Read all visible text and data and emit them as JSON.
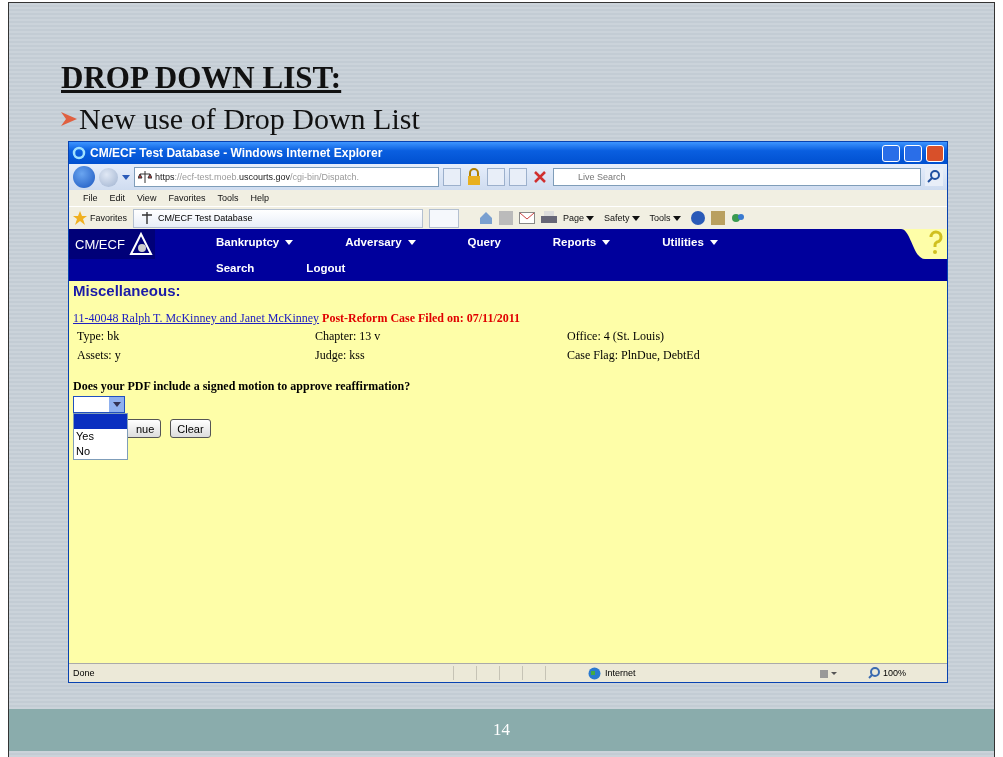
{
  "slide": {
    "title": "DROP DOWN LIST:",
    "bullet": "New use of Drop Down List",
    "page_number": "14"
  },
  "browser": {
    "title": "CM/ECF Test Database - Windows Internet Explorer",
    "address": [
      {
        "text": "https",
        "emphasis": true
      },
      {
        "text": "://ecf-test.moeb.",
        "emphasis": false
      },
      {
        "text": "uscourts.gov",
        "emphasis": true
      },
      {
        "text": "/cgi-bin/Dispatch.",
        "emphasis": false
      }
    ],
    "search": {
      "placeholder": "Live Search"
    },
    "menu": [
      "File",
      "Edit",
      "View",
      "Favorites",
      "Tools",
      "Help"
    ],
    "favorites": "Favorites",
    "tab": "CM/ECF Test Database",
    "commands": [
      "Page",
      "Safety",
      "Tools"
    ],
    "status": {
      "text": "Done",
      "zone": "Internet",
      "zoom": "100%"
    }
  },
  "app": {
    "logo": "CM/ECF",
    "nav": [
      [
        {
          "label": "Bankruptcy",
          "has_menu": true
        },
        {
          "label": "Adversary",
          "has_menu": true
        },
        {
          "label": "Query",
          "has_menu": false
        },
        {
          "label": "Reports",
          "has_menu": true
        },
        {
          "label": "Utilities",
          "has_menu": true
        }
      ],
      [
        {
          "label": "Search",
          "has_menu": false
        },
        {
          "label": "Logout",
          "has_menu": false
        }
      ]
    ],
    "heading": "Miscellaneous:",
    "case_link": "11-40048 Ralph T. McKinney and Janet McKinney",
    "case_status": "Post-Reform Case Filed on: 07/11/2011",
    "case_fields": [
      [
        "Type: bk",
        "Chapter: 13 v",
        "Office: 4 (St. Louis)"
      ],
      [
        "Assets: y",
        "Judge: kss",
        "Case Flag: PlnDue, DebtEd"
      ]
    ],
    "question": "Does your PDF include a signed motion to approve reaffirmation?",
    "dropdown": {
      "expanded": true,
      "options": [
        {
          "selected": true
        },
        {
          "label": "Yes",
          "selected": false
        },
        {
          "label": "No",
          "selected": false
        }
      ]
    },
    "buttons": [
      "nue",
      "Clear"
    ]
  }
}
